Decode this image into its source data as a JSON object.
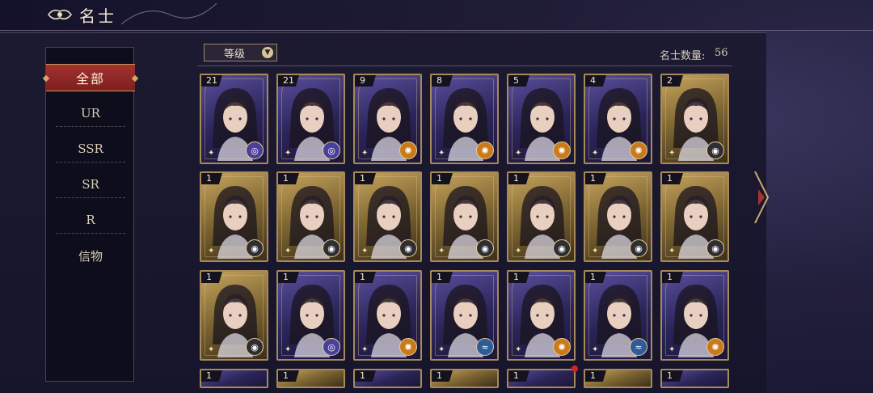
{
  "header": {
    "title": "名士"
  },
  "sidebar": {
    "items": [
      {
        "label": "全部",
        "active": true
      },
      {
        "label": "UR"
      },
      {
        "label": "SSR"
      },
      {
        "label": "SR"
      },
      {
        "label": "R"
      },
      {
        "label": "信物"
      }
    ]
  },
  "toolbar": {
    "sort_label": "等级",
    "count_label": "名士数量:",
    "count_value": "56"
  },
  "colors": {
    "accent_red": "#8e2626",
    "frame_gold": "#a8895a"
  },
  "cards": [
    {
      "level": "21",
      "bg": "purple",
      "badge": "b-purple",
      "badge_icon": "swirl-icon"
    },
    {
      "level": "21",
      "bg": "purple",
      "badge": "b-purple",
      "badge_icon": "swirl-icon"
    },
    {
      "level": "9",
      "bg": "purple",
      "badge": "b-orange",
      "badge_icon": "sun-icon"
    },
    {
      "level": "8",
      "bg": "purple",
      "badge": "b-orange",
      "badge_icon": "sun-icon"
    },
    {
      "level": "5",
      "bg": "purple",
      "badge": "b-orange",
      "badge_icon": "sun-icon"
    },
    {
      "level": "4",
      "bg": "purple",
      "badge": "b-orange",
      "badge_icon": "sun-icon"
    },
    {
      "level": "2",
      "bg": "gold",
      "badge": "b-dark",
      "badge_icon": "eye-icon"
    },
    {
      "level": "1",
      "bg": "gold",
      "badge": "b-dark",
      "badge_icon": "eye-icon"
    },
    {
      "level": "1",
      "bg": "gold",
      "badge": "b-dark",
      "badge_icon": "eye-icon"
    },
    {
      "level": "1",
      "bg": "gold",
      "badge": "b-dark",
      "badge_icon": "eye-icon"
    },
    {
      "level": "1",
      "bg": "gold",
      "badge": "b-dark",
      "badge_icon": "eye-icon"
    },
    {
      "level": "1",
      "bg": "gold",
      "badge": "b-dark",
      "badge_icon": "eye-icon"
    },
    {
      "level": "1",
      "bg": "gold",
      "badge": "b-dark",
      "badge_icon": "eye-icon"
    },
    {
      "level": "1",
      "bg": "gold",
      "badge": "b-dark",
      "badge_icon": "eye-icon"
    },
    {
      "level": "1",
      "bg": "gold",
      "badge": "b-dark",
      "badge_icon": "eye-icon"
    },
    {
      "level": "1",
      "bg": "purple",
      "badge": "b-purple",
      "badge_icon": "swirl-icon"
    },
    {
      "level": "1",
      "bg": "purple",
      "badge": "b-orange",
      "badge_icon": "sun-icon"
    },
    {
      "level": "1",
      "bg": "purple",
      "badge": "b-blue",
      "badge_icon": "wave-icon"
    },
    {
      "level": "1",
      "bg": "purple",
      "badge": "b-orange",
      "badge_icon": "sun-icon"
    },
    {
      "level": "1",
      "bg": "purple",
      "badge": "b-blue",
      "badge_icon": "wave-icon"
    },
    {
      "level": "1",
      "bg": "purple",
      "badge": "b-orange",
      "badge_icon": "sun-icon"
    }
  ],
  "partial_cards": [
    {
      "level": "1"
    },
    {
      "level": "1"
    },
    {
      "level": "1"
    },
    {
      "level": "1"
    },
    {
      "level": "1"
    },
    {
      "level": "1"
    },
    {
      "level": "1"
    }
  ]
}
